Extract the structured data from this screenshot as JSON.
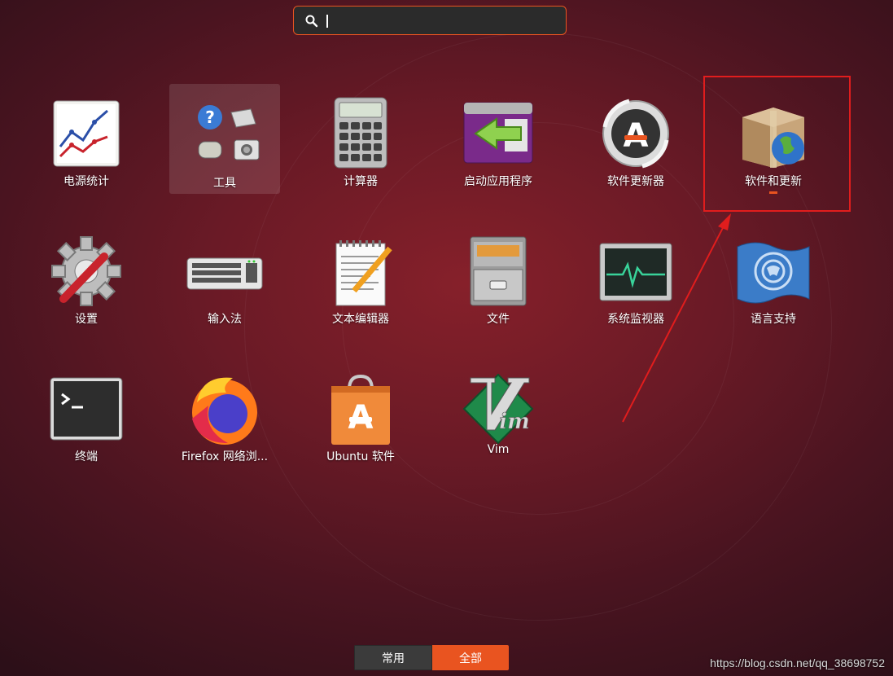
{
  "search": {
    "value": "",
    "placeholder": ""
  },
  "apps": [
    {
      "id": "power-stats",
      "label": "电源统计"
    },
    {
      "id": "tools",
      "label": "工具"
    },
    {
      "id": "calculator",
      "label": "计算器"
    },
    {
      "id": "startup",
      "label": "启动应用程序"
    },
    {
      "id": "software-updater",
      "label": "软件更新器"
    },
    {
      "id": "software-updates",
      "label": "软件和更新"
    },
    {
      "id": "settings",
      "label": "设置"
    },
    {
      "id": "input-method",
      "label": "输入法"
    },
    {
      "id": "text-editor",
      "label": "文本编辑器"
    },
    {
      "id": "files",
      "label": "文件"
    },
    {
      "id": "system-monitor",
      "label": "系统监视器"
    },
    {
      "id": "language-support",
      "label": "语言支持"
    },
    {
      "id": "terminal",
      "label": "终端"
    },
    {
      "id": "firefox",
      "label": "Firefox 网络浏..."
    },
    {
      "id": "ubuntu-software",
      "label": "Ubuntu 软件"
    },
    {
      "id": "vim",
      "label": "Vim"
    }
  ],
  "switcher": {
    "frequent": "常用",
    "all": "全部"
  },
  "watermark": "https://blog.csdn.net/qq_38698752",
  "colors": {
    "accent": "#e95420",
    "annotation": "#e11d1d"
  }
}
